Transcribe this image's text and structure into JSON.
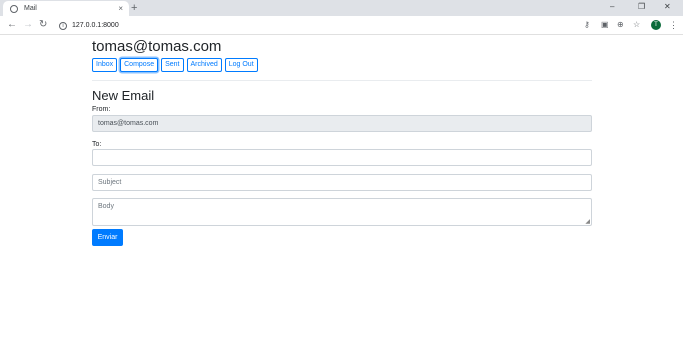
{
  "browser": {
    "tab_title": "Mail",
    "tab_close": "×",
    "new_tab": "+",
    "url": "127.0.0.1:8000",
    "profile_initial": "T",
    "win_minimize": "–",
    "win_restore": "❐",
    "win_close": "✕",
    "icons": [
      "back-icon",
      "forward-icon",
      "reload-icon",
      "info-icon",
      "key-icon",
      "translate-icon",
      "zoom-icon",
      "star-icon",
      "profile-avatar",
      "menu-icon"
    ]
  },
  "header": {
    "user_email": "tomas@tomas.com"
  },
  "nav": {
    "inbox": "Inbox",
    "compose": "Compose",
    "sent": "Sent",
    "archived": "Archived",
    "logout": "Log Out"
  },
  "compose": {
    "title": "New Email",
    "from_label": "From:",
    "from_value": "tomas@tomas.com",
    "to_label": "To:",
    "to_value": "",
    "subject_placeholder": "Subject",
    "body_placeholder": "Body",
    "submit_label": "Enviar"
  },
  "colors": {
    "primary": "#007bff",
    "disabled_bg": "#e9ecef",
    "text": "#212529"
  }
}
